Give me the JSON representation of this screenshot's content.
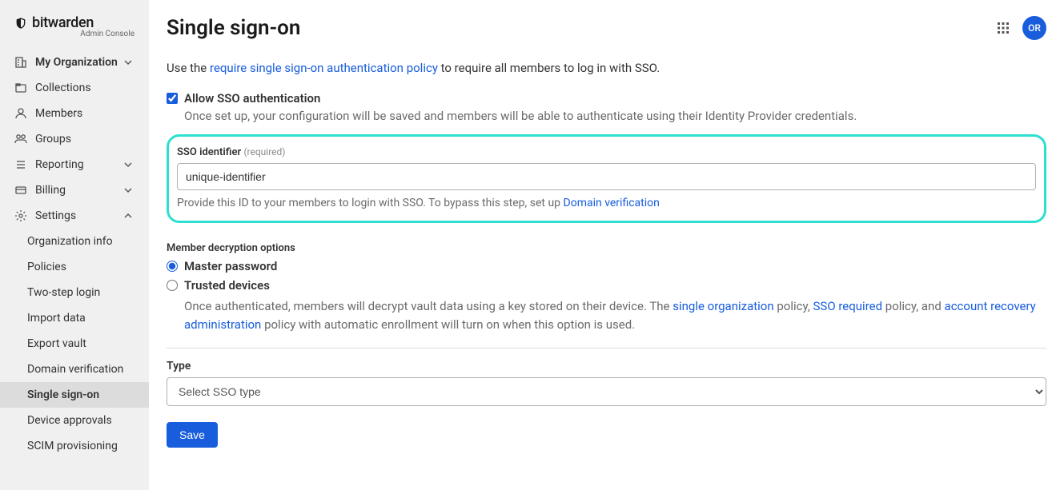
{
  "brand": {
    "name": "bitwarden",
    "sub": "Admin Console"
  },
  "sidebar": {
    "items": [
      {
        "label": "My Organization",
        "expandable": true,
        "expanded": false
      },
      {
        "label": "Collections"
      },
      {
        "label": "Members"
      },
      {
        "label": "Groups"
      },
      {
        "label": "Reporting",
        "expandable": true,
        "expanded": false
      },
      {
        "label": "Billing",
        "expandable": true,
        "expanded": false
      },
      {
        "label": "Settings",
        "expandable": true,
        "expanded": true
      }
    ],
    "settings_sub": [
      {
        "label": "Organization info"
      },
      {
        "label": "Policies"
      },
      {
        "label": "Two-step login"
      },
      {
        "label": "Import data"
      },
      {
        "label": "Export vault"
      },
      {
        "label": "Domain verification"
      },
      {
        "label": "Single sign-on",
        "active": true
      },
      {
        "label": "Device approvals"
      },
      {
        "label": "SCIM provisioning"
      }
    ]
  },
  "header": {
    "title": "Single sign-on",
    "avatar_initials": "OR"
  },
  "intro": {
    "prefix": "Use the ",
    "link": "require single sign-on authentication policy",
    "suffix": " to require all members to log in with SSO."
  },
  "allow_sso": {
    "label": "Allow SSO authentication",
    "checked": true,
    "helper": "Once set up, your configuration will be saved and members will be able to authenticate using their Identity Provider credentials."
  },
  "sso_id": {
    "label": "SSO identifier ",
    "required": "(required)",
    "value": "unique-identifier",
    "help_prefix": "Provide this ID to your members to login with SSO. To bypass this step, set up ",
    "help_link": "Domain verification"
  },
  "decryption": {
    "heading": "Member decryption options",
    "options": [
      {
        "label": "Master password",
        "checked": true
      },
      {
        "label": "Trusted devices",
        "checked": false
      }
    ],
    "trusted_help": {
      "p1": "Once authenticated, members will decrypt vault data using a key stored on their device. The ",
      "l1": "single organization",
      "p2": " policy, ",
      "l2": "SSO required",
      "p3": " policy, and ",
      "l3": "account recovery administration",
      "p4": " policy with automatic enrollment will turn on when this option is used."
    }
  },
  "type_field": {
    "label": "Type",
    "placeholder": "Select SSO type"
  },
  "actions": {
    "save": "Save"
  }
}
